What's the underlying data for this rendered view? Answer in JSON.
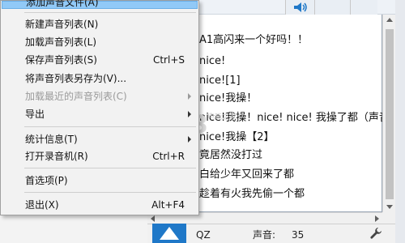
{
  "app": {
    "title_fragment": "巴",
    "bottom": {
      "track_label": "QZ",
      "volume_label": "声音:",
      "volume_value": "35"
    }
  },
  "list_items": [
    "A1高闪来一个好吗！！",
    "nice!",
    "nice![1]",
    "nice!我操！",
    "nice!我操！nice! nice! 我操了都（声音较大）",
    "nice!我操【2】",
    "竟居然没打过",
    "白给少年又回来了都",
    "趁着有火我先偷一个都"
  ],
  "watermark": {
    "text": "K73",
    "sub": "电玩之家"
  },
  "menu": {
    "items": [
      {
        "label": "添加声音文件(A)",
        "shortcut": "",
        "submenu": false,
        "disabled": false,
        "highlighted": true
      },
      {
        "label": "新建声音列表(N)",
        "shortcut": "",
        "submenu": false,
        "disabled": false
      },
      {
        "label": "加载声音列表(L)",
        "shortcut": "",
        "submenu": false,
        "disabled": false
      },
      {
        "label": "保存声音列表(S)",
        "shortcut": "Ctrl+S",
        "submenu": false,
        "disabled": false
      },
      {
        "label": "将声音列表另存为(V)...",
        "shortcut": "",
        "submenu": false,
        "disabled": false
      },
      {
        "label": "加载最近的声音列表(C)",
        "shortcut": "",
        "submenu": true,
        "disabled": true
      },
      {
        "label": "导出",
        "shortcut": "",
        "submenu": true,
        "disabled": false
      },
      {
        "label": "统计信息(T)",
        "shortcut": "",
        "submenu": true,
        "disabled": false
      },
      {
        "label": "打开录音机(R)",
        "shortcut": "Ctrl+R",
        "submenu": false,
        "disabled": false
      },
      {
        "label": "首选项(P)",
        "shortcut": "",
        "submenu": false,
        "disabled": false
      },
      {
        "label": "退出(X)",
        "shortcut": "Alt+F4",
        "submenu": false,
        "disabled": false
      }
    ]
  },
  "colors": {
    "menu_highlight": "#91c9f7",
    "play_button": "#1f78c8",
    "menu_background": "#f2f2f2"
  }
}
